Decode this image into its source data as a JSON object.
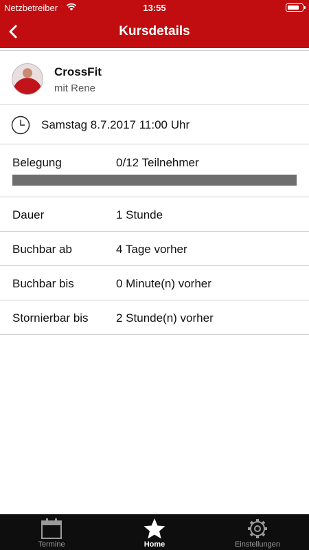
{
  "status_bar": {
    "carrier": "Netzbetreiber",
    "time": "13:55",
    "battery_level": 0.85
  },
  "nav": {
    "title": "Kursdetails"
  },
  "course": {
    "name": "CrossFit",
    "trainer": "mit Rene"
  },
  "schedule": {
    "date": "Samstag 8.7.2017 11:00 Uhr"
  },
  "occupancy": {
    "label": "Belegung",
    "value": "0/12 Teilnehmer",
    "fraction": 0
  },
  "details": [
    {
      "label": "Dauer",
      "value": "1 Stunde"
    },
    {
      "label": "Buchbar ab",
      "value": "4 Tage vorher"
    },
    {
      "label": "Buchbar bis",
      "value": "0 Minute(n) vorher"
    },
    {
      "label": "Stornierbar bis",
      "value": "2 Stunde(n) vorher"
    }
  ],
  "tabs": [
    {
      "label": "Termine",
      "icon": "calendar-icon",
      "active": false
    },
    {
      "label": "Home",
      "icon": "star-icon",
      "active": true
    },
    {
      "label": "Einstellungen",
      "icon": "gear-icon",
      "active": false
    }
  ],
  "colors": {
    "brand_red": "#c20d10",
    "tab_bar": "#0e0e0e",
    "occupancy_track": "#6e6e6e"
  }
}
